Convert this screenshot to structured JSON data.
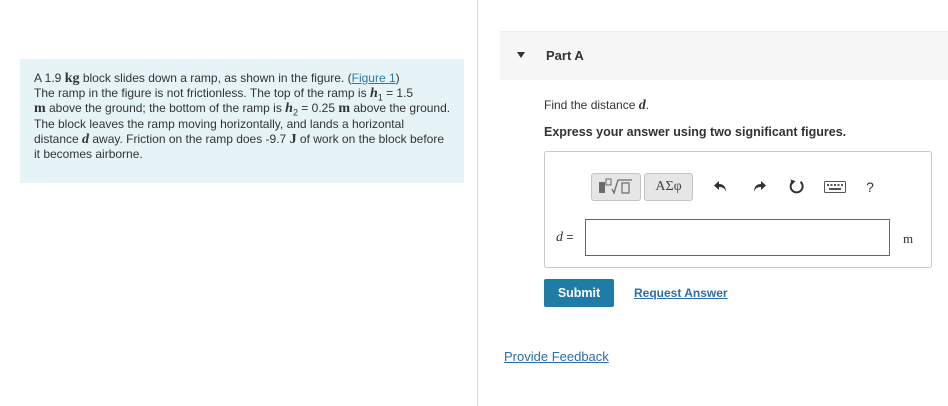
{
  "problem": {
    "t1": "A 1.9 ",
    "mass_unit": "kg",
    "t2": " block slides down a ramp, as shown in the figure. (",
    "figure_link": "Figure 1",
    "t3": ")",
    "t4": "The ramp in the figure is not frictionless. The top of the ramp is ",
    "h1_var": "h",
    "h1_sub": "1",
    "t5": " = 1.5",
    "h1_unit": "m",
    "t6": " above the ground; the bottom of the ramp is ",
    "h2_var": "h",
    "h2_sub": "2",
    "t7": " = 0.25 ",
    "h2_unit": "m",
    "t8": " above the ground. The block leaves the ramp moving horizontally, and lands a horizontal distance ",
    "d_var": "d",
    "t9": " away. Friction on the ramp does -9.7 ",
    "work_unit": "J",
    "t10": " of work on the block before it becomes airborne."
  },
  "part": {
    "title": "Part A",
    "find_prefix": "Find the distance ",
    "find_var": "d",
    "find_suffix": ".",
    "instruction": "Express your answer using two significant figures."
  },
  "answer": {
    "var": "d",
    "equals": " =",
    "value": "",
    "unit": "m",
    "symbols_label": "ΑΣφ",
    "help_label": "?"
  },
  "actions": {
    "submit": "Submit",
    "request": "Request Answer",
    "feedback": "Provide Feedback"
  },
  "colors": {
    "problem_bg": "#e6f4f7",
    "accent": "#1e7ca6",
    "link": "#2a6fa8"
  },
  "icons": [
    "templates-icon",
    "symbols-icon",
    "undo-icon",
    "redo-icon",
    "reset-icon",
    "keyboard-icon",
    "help-icon"
  ]
}
